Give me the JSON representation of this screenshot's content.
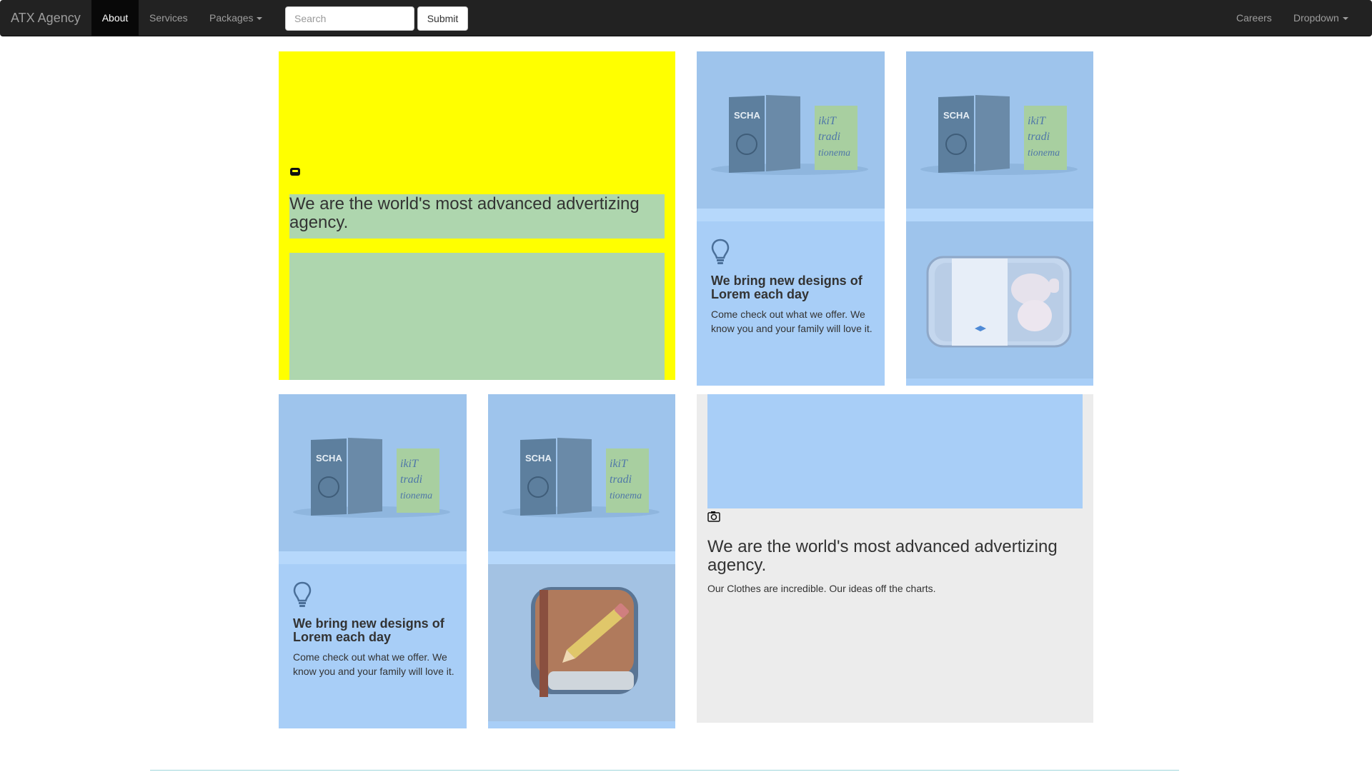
{
  "navbar": {
    "brand": "ATX Agency",
    "left_items": [
      {
        "label": "About",
        "active": true
      },
      {
        "label": "Services",
        "active": false
      },
      {
        "label": "Packages",
        "dropdown": true
      }
    ],
    "search_placeholder": "Search",
    "submit_label": "Submit",
    "right_items": [
      {
        "label": "Careers"
      },
      {
        "label": "Dropdown",
        "dropdown": true
      }
    ]
  },
  "hero": {
    "icon": "bag-icon",
    "heading": "We are the world's most advanced advertizing agency."
  },
  "cards": [
    {
      "image": "books-mockup",
      "icon": "lightbulb-icon",
      "heading": "We bring new designs of Lorem each day",
      "text": "Come check out what we offer. We know you and your family will love it."
    },
    {
      "image": "books-mockup",
      "second_image": "chicken-package-mockup"
    },
    {
      "image": "books-mockup",
      "icon": "lightbulb-icon",
      "heading": "We bring new designs of Lorem each day",
      "text": "Come check out what we offer. We know you and your family will love it."
    },
    {
      "image": "books-mockup",
      "second_image": "notebook-pencil-app-icon"
    }
  ],
  "feature": {
    "icon": "camera-icon",
    "heading": "We are the world's most advanced advertizing agency.",
    "text": "Our Clothes are incredible. Our ideas off the charts."
  },
  "colors": {
    "navbar": "#222222",
    "hero_background": "#ffff00",
    "hero_box": "#aed6ae",
    "card_background": "#a8cef7",
    "feature_background": "#ececec"
  }
}
